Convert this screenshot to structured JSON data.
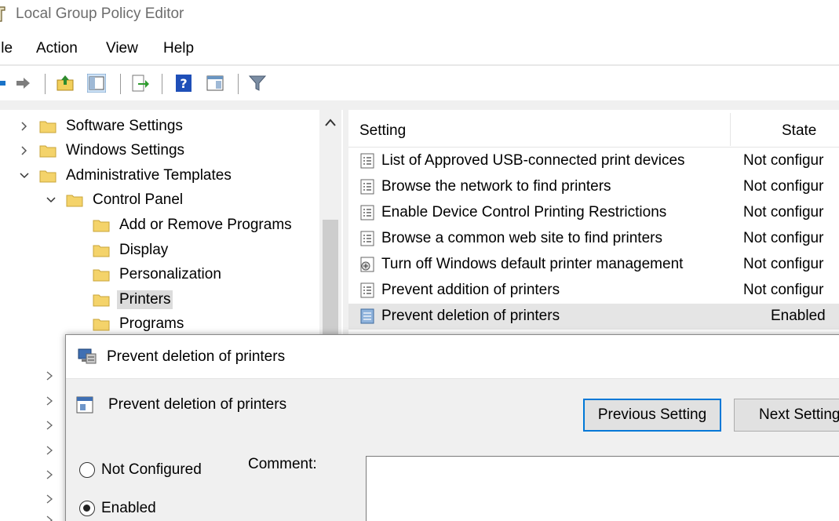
{
  "window": {
    "title": "Local Group Policy Editor"
  },
  "menu": {
    "items": [
      "ile",
      "Action",
      "View",
      "Help"
    ]
  },
  "toolbar": {
    "icons": [
      "back-arrow-icon",
      "forward-arrow-icon",
      "up-folder-icon",
      "show-hide-tree-icon",
      "export-list-icon",
      "help-icon",
      "properties-view-icon",
      "filter-icon"
    ]
  },
  "tree": {
    "items": [
      {
        "label": "Software Settings",
        "state": "collapsed"
      },
      {
        "label": "Windows Settings",
        "state": "collapsed"
      },
      {
        "label": "Administrative Templates",
        "state": "expanded"
      },
      {
        "label": "Control Panel",
        "state": "expanded"
      },
      {
        "label": "Add or Remove Programs",
        "state": "leaf"
      },
      {
        "label": "Display",
        "state": "leaf"
      },
      {
        "label": "Personalization",
        "state": "leaf"
      },
      {
        "label": "Printers",
        "state": "leaf",
        "selected": true
      },
      {
        "label": "Programs",
        "state": "leaf"
      }
    ]
  },
  "list": {
    "headers": {
      "setting": "Setting",
      "state": "State"
    },
    "rows": [
      {
        "name": "List of Approved USB-connected print devices",
        "state": "Not configur",
        "icon": "policy-setting-icon"
      },
      {
        "name": "Browse the network to find printers",
        "state": "Not configur",
        "icon": "policy-setting-icon"
      },
      {
        "name": "Enable Device Control Printing Restrictions",
        "state": "Not configur",
        "icon": "policy-setting-icon"
      },
      {
        "name": "Browse a common web site to find printers",
        "state": "Not configur",
        "icon": "policy-setting-icon"
      },
      {
        "name": "Turn off Windows default printer management",
        "state": "Not configur",
        "icon": "policy-setting-special-icon"
      },
      {
        "name": "Prevent addition of printers",
        "state": "Not configur",
        "icon": "policy-setting-icon"
      },
      {
        "name": "Prevent deletion of printers",
        "state": "Enabled",
        "icon": "policy-setting-enabled-icon",
        "selected": true
      }
    ]
  },
  "dialog": {
    "title": "Prevent deletion of printers",
    "heading": "Prevent deletion of printers",
    "buttons": {
      "previous": "Previous Setting",
      "next": "Next Setting"
    },
    "options": [
      {
        "label": "Not Configured",
        "checked": false
      },
      {
        "label": "Enabled",
        "checked": true
      }
    ],
    "comment_label": "Comment:"
  },
  "colors": {
    "accent": "#0078d7",
    "selection": "#e5e5e5",
    "folder": "#f4d36a"
  }
}
